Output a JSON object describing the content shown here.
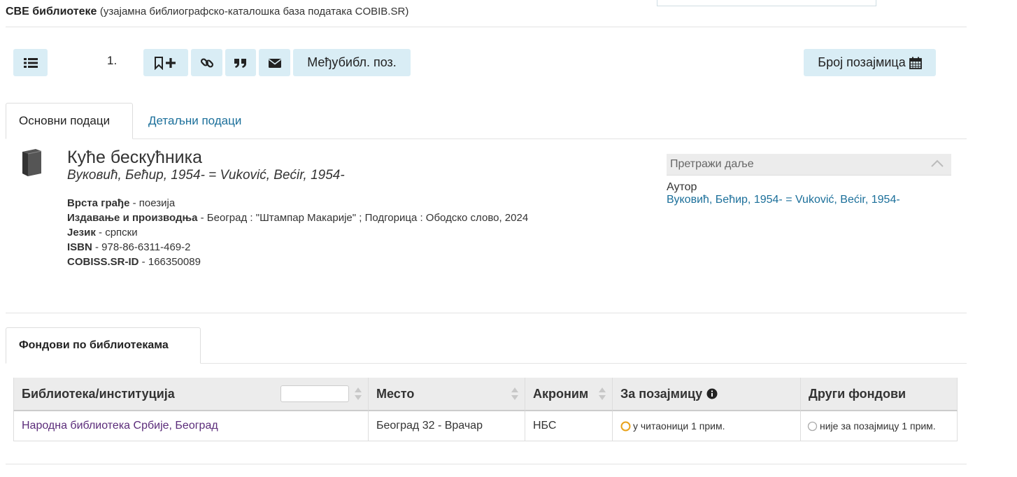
{
  "header": {
    "title_bold": "СВЕ библиотеке",
    "title_sub": "(узајамна библиографско-каталошка база података COBIB.SR)"
  },
  "toolbar": {
    "record_number": "1.",
    "ill_label": "Међубибл. поз.",
    "loans_label": "Број позајмица"
  },
  "tabs": {
    "basic": "Основни подаци",
    "detailed": "Детаљни подаци"
  },
  "record": {
    "title": "Куће бескућника",
    "author": "Вуковић, Бећир, 1954- = Vuković, Bećir, 1954-",
    "fields": [
      {
        "label": "Врста грађе",
        "value": " - поезија"
      },
      {
        "label": "Издавање и производња",
        "value": " - Београд : \"Штампар Макарије\" ; Подгорица : Ободско слово, 2024"
      },
      {
        "label": "Језик",
        "value": " - српски"
      },
      {
        "label": "ISBN",
        "value": " - 978-86-6311-469-2"
      },
      {
        "label": "COBISS.SR-ID",
        "value": " - 166350089"
      }
    ]
  },
  "search_further": {
    "header": "Претражи даље",
    "author_label": "Аутор",
    "author_link": "Вуковић, Бећир, 1954- = Vuković, Bećir, 1954-"
  },
  "holdings": {
    "tab_label": "Фондови по библиотекама",
    "columns": [
      "Библиотека/институција",
      "Место",
      "Акроним",
      "За позајмицу",
      "Други фондови"
    ],
    "filter_value": "",
    "rows": [
      {
        "library": "Народна библиотека Србије, Београд",
        "place": "Београд 32 - Врачар",
        "acronym": "НБС",
        "loan": "у читаоници 1 прим.",
        "other": "није за позајмицу 1 прим."
      }
    ]
  },
  "colors": {
    "accent_bg": "#d9edf5",
    "link": "#1b6f9a",
    "library_link": "#5b2c7a",
    "status_orange": "#e8a21a"
  }
}
